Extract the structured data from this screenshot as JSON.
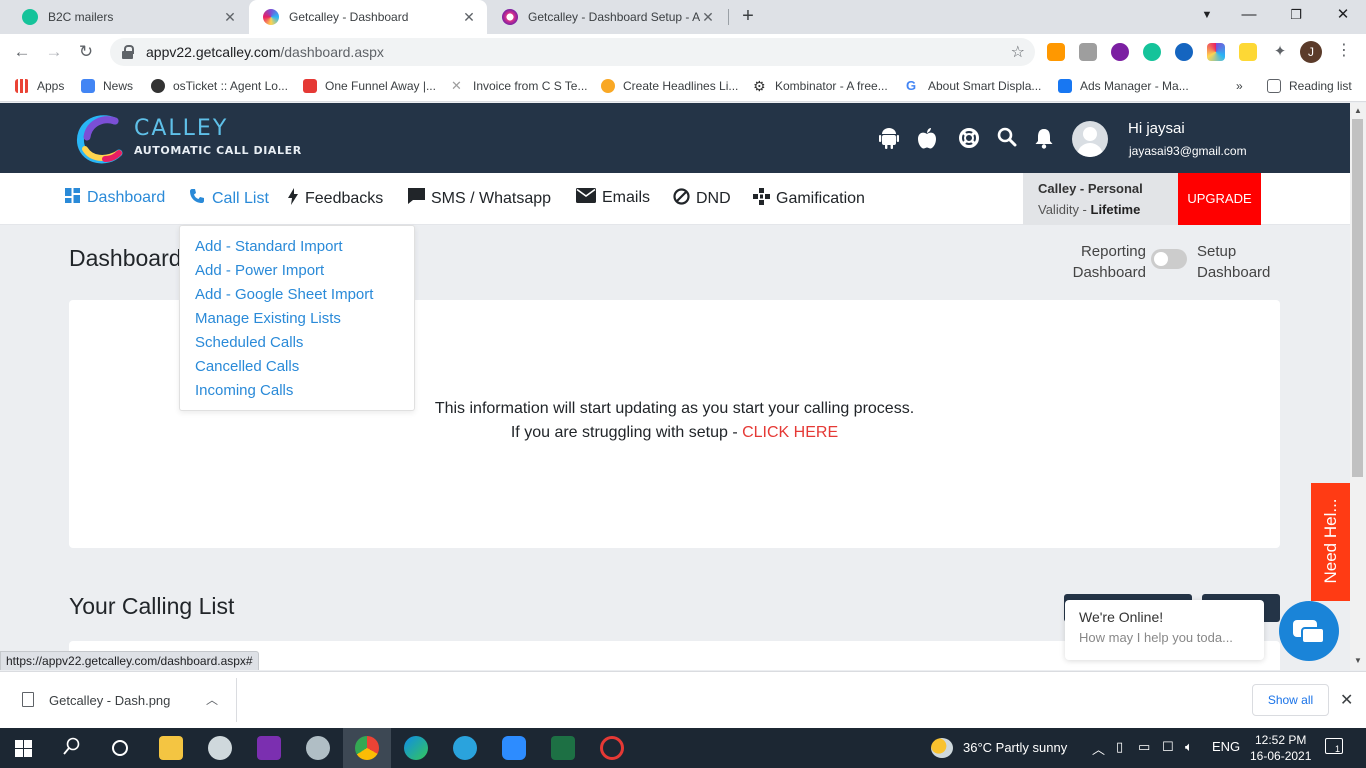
{
  "browser": {
    "tabs": [
      {
        "title": "B2C mailers",
        "active": false,
        "icon_color": "#15c39a"
      },
      {
        "title": "Getcalley - Dashboard",
        "active": true,
        "icon_color": "#7b4fd6"
      },
      {
        "title": "Getcalley - Dashboard Setup - Au",
        "active": false,
        "icon_color": "#e2338a"
      }
    ],
    "tab_close_glyph": "✕",
    "new_tab_glyph": "+",
    "url_host": "appv22.getcalley.com",
    "url_path": "/dashboard.aspx",
    "profile_initial": "J",
    "bookmarks": [
      {
        "label": "Apps",
        "icon_color": "#ea4335"
      },
      {
        "label": "News",
        "icon_color": "#4285f4"
      },
      {
        "label": "osTicket :: Agent Lo...",
        "icon_color": "#333333"
      },
      {
        "label": "One Funnel Away |...",
        "icon_color": "#e53935"
      },
      {
        "label": "Invoice from C S Te...",
        "icon_color": "#9e9e9e"
      },
      {
        "label": "Create Headlines Li...",
        "icon_color": "#f9a825"
      },
      {
        "label": "Kombinator - A free...",
        "icon_color": "#333333"
      },
      {
        "label": "About Smart Displa...",
        "icon_color": "#4285f4"
      },
      {
        "label": "Ads Manager - Ma...",
        "icon_color": "#1877f2"
      }
    ],
    "bookmarks_overflow": "»",
    "reading_list": "Reading list"
  },
  "app": {
    "logo_title": "CALLEY",
    "logo_subtitle": "AUTOMATIC CALL DIALER",
    "greeting": "Hi jaysai",
    "email": "jayasai93@gmail.com",
    "header_icons": [
      "android-icon",
      "apple-icon",
      "help-lifebuoy-icon",
      "search-icon",
      "bell-icon"
    ],
    "menu": [
      {
        "label": "Dashboard",
        "icon": "dashboard-grid-icon",
        "active": true
      },
      {
        "label": "Call List",
        "icon": "phone-icon",
        "active": true
      },
      {
        "label": "Feedbacks",
        "icon": "bolt-icon",
        "active": false
      },
      {
        "label": "SMS / Whatsapp",
        "icon": "chat-icon",
        "active": false
      },
      {
        "label": "Emails",
        "icon": "envelope-icon",
        "active": false
      },
      {
        "label": "DND",
        "icon": "block-icon",
        "active": false
      },
      {
        "label": "Gamification",
        "icon": "gamepad-icon",
        "active": false
      }
    ],
    "plan_name": "Calley - Personal",
    "validity_label": "Validity - ",
    "validity_value": "Lifetime",
    "upgrade_label": "UPGRADE",
    "call_list_dropdown": [
      "Add - Standard Import",
      "Add - Power Import",
      "Add - Google Sheet Import",
      "Manage Existing Lists",
      "Scheduled Calls",
      "Cancelled Calls",
      "Incoming Calls"
    ],
    "page_title": "Dashboard",
    "toggle_left": "Reporting Dashboard",
    "toggle_right": "Setup Dashboard",
    "info_line_1": "This information will start updating as you start your calling process.",
    "info_line_2_prefix": "If you are struggling with setup - ",
    "info_line_2_link": "CLICK HERE",
    "calling_list_title": "Your Calling List",
    "chat_title": "We're Online!",
    "chat_subtitle": "How may I help you toda...",
    "need_help_label": "Need Hel...",
    "status_url": "https://appv22.getcalley.com/dashboard.aspx#",
    "colors": {
      "header_bg": "#243447",
      "accent_blue": "#2a8ad8",
      "upgrade_red": "#ff0000",
      "link_red": "#e53935",
      "help_orange": "#ff3b14",
      "chat_blue": "#1a84d8"
    }
  },
  "downloads": {
    "file_name": "Getcalley - Dash.png",
    "show_all": "Show all"
  },
  "taskbar": {
    "weather": "36°C  Partly sunny",
    "language": "ENG",
    "time": "12:52 PM",
    "date": "16-06-2021",
    "notification_count": "1"
  }
}
